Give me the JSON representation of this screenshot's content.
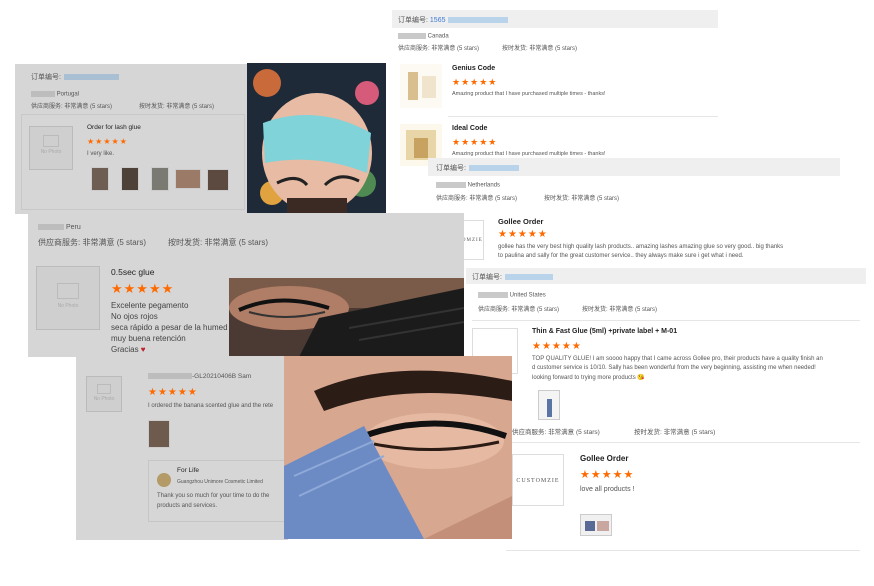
{
  "card_top_right": {
    "order_label": "订单编号:",
    "order_number": "1565",
    "country": "Canada",
    "supplier_service": "供应商服务: 非常满意",
    "supplier_stars": "(5 stars)",
    "on_time": "按时发货: 非常满意",
    "on_time_stars": "(5 stars)",
    "reviews": [
      {
        "product": "Genius Code",
        "stars": "★★★★★",
        "text": "Amazing product that I have purchased multiple times - thanks!"
      },
      {
        "product": "Ideal Code",
        "stars": "★★★★★",
        "text": "Amazing product that I have purchased multiple times - thanks!"
      }
    ]
  },
  "card_portugal": {
    "order_label": "订单编号:",
    "country": "Portugal",
    "supplier_service": "供应商服务: 非常满意",
    "supplier_stars": "(5 stars)",
    "on_time": "按时发货: 非常满意",
    "on_time_stars": "(5 stars)",
    "no_photo": "No Photo",
    "product": "Order for lash glue",
    "stars": "★★★★★",
    "text": "I very like."
  },
  "card_netherlands": {
    "order_label": "订单编号:",
    "country": "Netherlands",
    "supplier_service": "供应商服务: 非常满意",
    "supplier_stars": "(5 stars)",
    "on_time": "按时发货: 非常满意",
    "on_time_stars": "(5 stars)",
    "customize": "CUSTOMZIE",
    "product": "Gollee Order",
    "stars": "★★★★★",
    "text_1": "gollee has the very best high quality lash products.. amazing lashes amazing glue so very good.. big thanks",
    "text_2": "to paulina and sally for the great customer service.. they always make sure i get what i need."
  },
  "card_peru": {
    "country": "Peru",
    "supplier_service": "供应商服务: 非常满意",
    "supplier_stars": "(5 stars)",
    "on_time": "按时发货: 非常满意",
    "on_time_stars": "(5 stars)",
    "no_photo": "No Photo",
    "product": "0.5sec glue",
    "stars": "★★★★★",
    "lines": [
      "Excelente pegamento",
      "No ojos rojos",
      "seca rápido a pesar de la humed",
      "muy buena retención",
      "Gracias"
    ],
    "heart": "♥"
  },
  "card_us": {
    "order_label": "订单编号:",
    "country": "United States",
    "supplier_service": "供应商服务: 非常满意",
    "supplier_stars": "(5 stars)",
    "on_time": "按时发货: 非常满意",
    "on_time_stars": "(5 stars)",
    "product": "Thin & Fast Glue (5ml) +private label + M-01",
    "stars": "★★★★★",
    "text_1": "TOP QUALITY GLUE! I am soooo happy that I came across Gollee pro, their products have a quality finish an",
    "text_2": "d customer service is 10/10. Sally has been wonderful from the very beginning, assisting me when needed!",
    "text_3": "looking forward to trying more products",
    "emoji": "😘",
    "supplier_service_2": "供应商服务: 非常满意",
    "supplier_stars_2": "(5 stars)",
    "on_time_2": "按时发货: 非常满意",
    "on_time_stars_2": "(5 stars)",
    "customize": "CUSTOMZIE",
    "product_2": "Gollee Order",
    "stars_2": "★★★★★",
    "text_4": "love all products !"
  },
  "card_sam": {
    "reviewer": "-GL20210406B Sam",
    "no_photo": "No Photo",
    "stars": "★★★★★",
    "text": "I ordered the banana scented glue and the rete",
    "reply_title": "For Life",
    "reply_company": "Guangzhou Unimore Cosmetic Limited",
    "reply_text_1": "Thank you so much for your time to do the",
    "reply_text_2": "products and services."
  },
  "colors": {
    "star": "#ff6a00",
    "grey_card": "#d6d6d6",
    "blur_blue": "#b9d3ea"
  }
}
